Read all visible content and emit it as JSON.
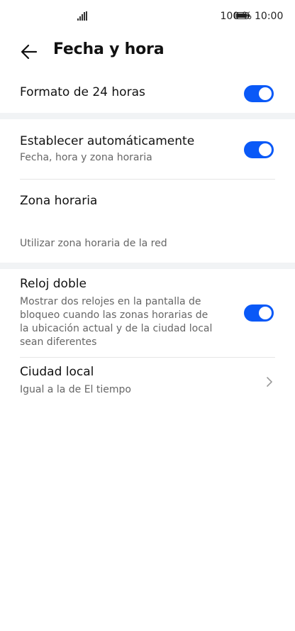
{
  "status_bar": {
    "battery_percent": "100 %",
    "time": "10:00"
  },
  "header": {
    "title": "Fecha y hora"
  },
  "settings": {
    "format24": {
      "label": "Formato de 24 horas",
      "enabled": true
    },
    "auto": {
      "label": "Establecer automáticamente",
      "sublabel": "Fecha, hora y zona horaria",
      "enabled": true
    },
    "timezone": {
      "label": "Zona horaria",
      "sublabel": "Utilizar zona horaria de la red"
    },
    "dual_clock": {
      "label": "Reloj doble",
      "desc_lines": [
        "Mostrar dos relojes en la pantalla de",
        "bloqueo cuando las zonas horarias de",
        "la ubicación actual y de la ciudad local",
        "sean diferentes"
      ],
      "enabled": true
    },
    "home_city": {
      "label": "Ciudad local",
      "sublabel": "Igual a la de El tiempo"
    }
  },
  "colors": {
    "accent": "#0a59f7",
    "section_gap": "#f1f3f5"
  }
}
